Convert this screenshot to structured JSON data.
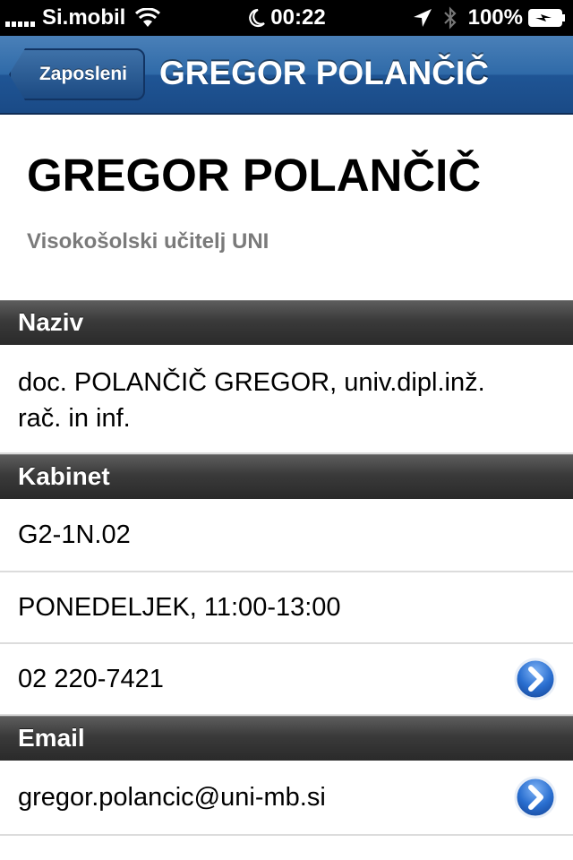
{
  "status_bar": {
    "carrier": "Si.mobil",
    "time": "00:22",
    "battery": "100%"
  },
  "nav": {
    "back_label": "Zaposleni",
    "title": "GREGOR POLANČIČ"
  },
  "person": {
    "name": "GREGOR POLANČIČ",
    "role": "Visokošolski učitelj UNI"
  },
  "sections": [
    {
      "header": "Naziv"
    },
    {
      "header": "Kabinet"
    },
    {
      "header": "Email"
    }
  ],
  "rows": {
    "naziv": [
      "doc. POLANČIČ GREGOR, univ.dipl.inž.",
      "rač. in inf."
    ],
    "room": "G2-1N.02",
    "hours": "PONEDELJEK, 11:00-13:00",
    "phone": "02 220-7421",
    "email": "gregor.polancic@uni-mb.si"
  },
  "icons": {
    "wifi": "wifi-icon",
    "moon": "do-not-disturb-moon-icon",
    "location": "location-arrow-icon",
    "bluetooth": "bluetooth-icon",
    "battery": "battery-charging-icon",
    "disclosure": "chevron-right-circle-icon"
  },
  "colors": {
    "nav_bar": "#2f6aa8",
    "section_header": "#3a3a3a",
    "disclosure_button": "#2a6fd0"
  }
}
